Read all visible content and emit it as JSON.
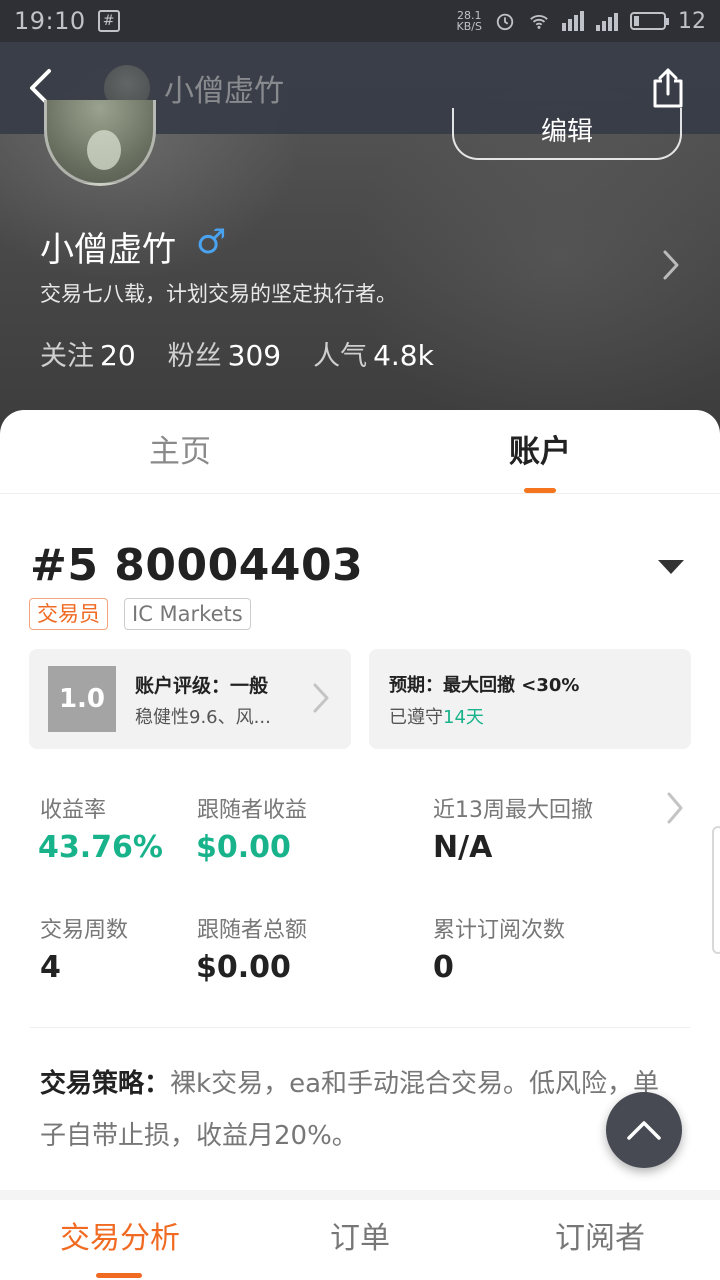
{
  "status_bar": {
    "time": "19:10",
    "network_speed": "28.1",
    "network_unit": "KB/S",
    "battery": "12"
  },
  "nav": {
    "title": "小僧虚竹"
  },
  "profile": {
    "edit_label": "编辑",
    "name": "小僧虚竹",
    "gender_symbol": "♂",
    "bio": "交易七八载，计划交易的坚定执行者。",
    "stats": [
      {
        "label": "关注",
        "value": "20"
      },
      {
        "label": "粉丝",
        "value": "309"
      },
      {
        "label": "人气",
        "value": "4.8k"
      }
    ]
  },
  "tabs": [
    {
      "label": "主页",
      "active": false
    },
    {
      "label": "账户",
      "active": true
    }
  ],
  "account": {
    "number": "#5 80004403",
    "role_tag": "交易员",
    "broker_tag": "IC Markets",
    "rating": {
      "score": "1.0",
      "title": "账户评级：一般",
      "subtitle": "稳健性9.6、风..."
    },
    "expectation": {
      "title": "预期：最大回撤 <30%",
      "subtitle_prefix": "已遵守",
      "subtitle_highlight": "14天"
    },
    "metrics": [
      {
        "label": "收益率",
        "value": "43.76%",
        "highlight": true
      },
      {
        "label": "跟随者收益",
        "value": "$0.00",
        "highlight": true
      },
      {
        "label": "近13周最大回撤",
        "value": "N/A",
        "highlight": false
      },
      {
        "label": "交易周数",
        "value": "4",
        "highlight": false
      },
      {
        "label": "跟随者总额",
        "value": "$0.00",
        "highlight": false
      },
      {
        "label": "累计订阅次数",
        "value": "0",
        "highlight": false
      }
    ],
    "strategy_label": "交易策略：",
    "strategy_text": "裸k交易，ea和手动混合交易。低风险，单子自带止损，收益月20%。"
  },
  "bottom_tabs": [
    {
      "label": "交易分析",
      "active": true
    },
    {
      "label": "订单",
      "active": false
    },
    {
      "label": "订阅者",
      "active": false
    }
  ],
  "colors": {
    "accent": "#f06a22",
    "positive": "#18b38a",
    "gender": "#4aa3f0"
  },
  "icons": {
    "back": "back-arrow-icon",
    "share": "share-icon",
    "dropdown": "caret-down-icon",
    "scroll_top": "chevron-up-icon"
  }
}
